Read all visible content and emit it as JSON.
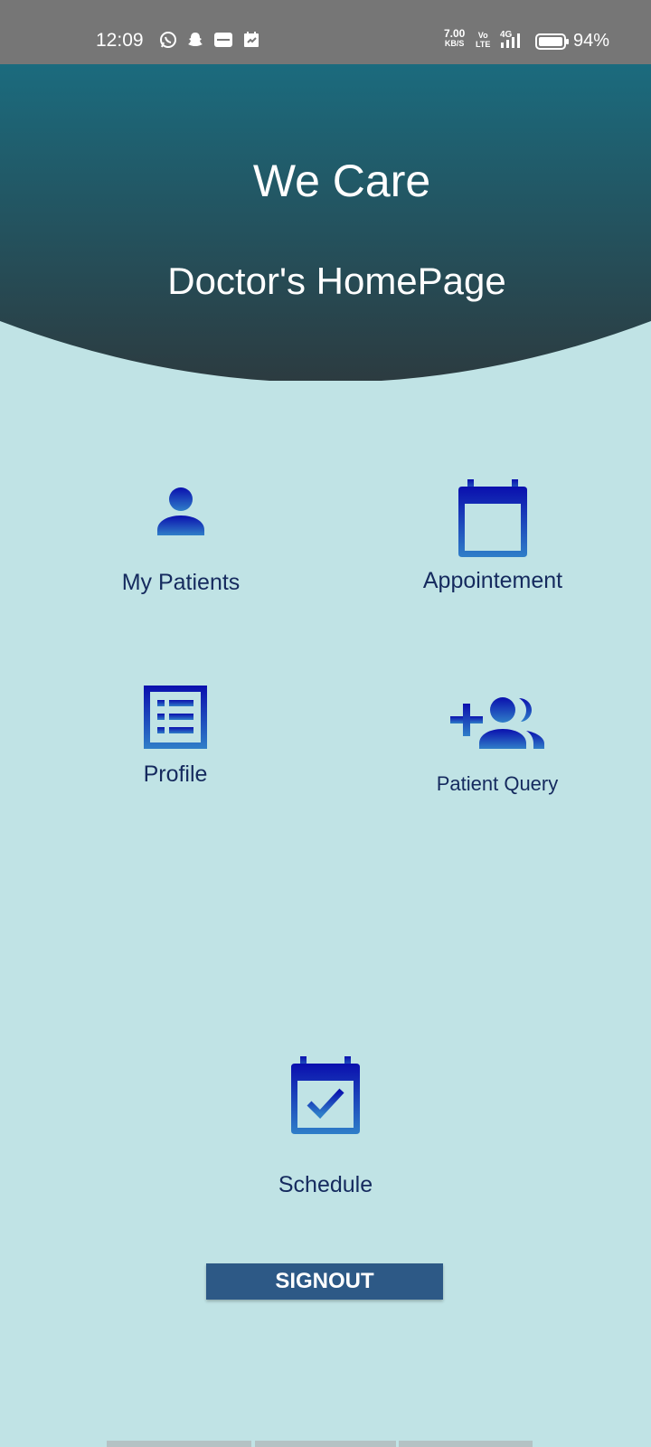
{
  "status_bar": {
    "time": "12:09",
    "net_speed": "7.00",
    "net_unit": "KB/S",
    "volte_top": "Vo",
    "volte_bottom": "LTE",
    "network": "4G",
    "battery": "94%",
    "left_icons": [
      "whatsapp-icon",
      "snapchat-icon",
      "app-notification-icon",
      "calendar-notification-icon"
    ]
  },
  "header": {
    "app_title": "We Care",
    "page_title": "Doctor's HomePage"
  },
  "tiles": {
    "my_patients": {
      "label": "My Patients",
      "icon": "person-icon"
    },
    "appointment": {
      "label": "Appointement",
      "icon": "calendar-icon"
    },
    "profile": {
      "label": "Profile",
      "icon": "list-icon"
    },
    "patient_query": {
      "label": "Patient Query",
      "icon": "add-group-icon"
    },
    "schedule": {
      "label": "Schedule",
      "icon": "calendar-check-icon"
    }
  },
  "signout": {
    "label": "SIGNOUT"
  },
  "colors": {
    "background": "#c0e3e5",
    "header_top": "#1b6b7e",
    "header_bottom": "#2c3b40",
    "icon_top": "#0a0fae",
    "icon_bottom": "#2f7ec8",
    "label_text": "#152a5e",
    "button": "#2d5986"
  }
}
